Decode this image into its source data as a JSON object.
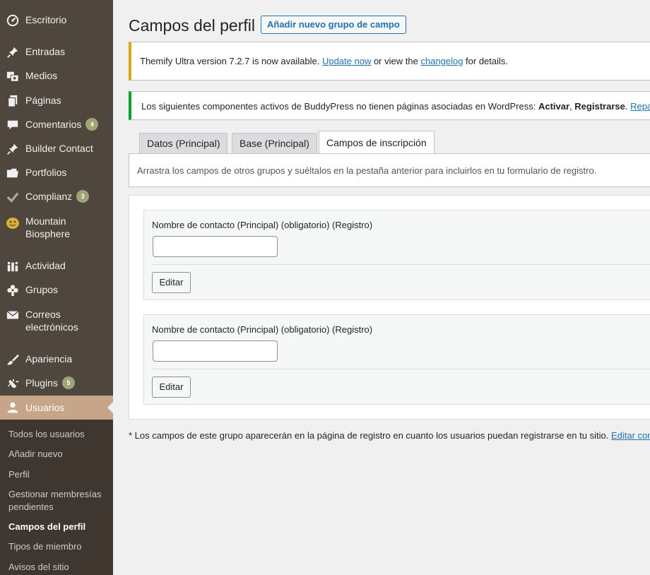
{
  "sidebar": {
    "items": [
      {
        "label": "Escritorio",
        "icon": "dashboard-icon"
      },
      {
        "label": "Entradas",
        "icon": "pin-icon"
      },
      {
        "label": "Medios",
        "icon": "media-icon"
      },
      {
        "label": "Páginas",
        "icon": "pages-icon"
      },
      {
        "label": "Comentarios",
        "icon": "comments-icon",
        "badge": "4"
      },
      {
        "label": "Builder Contact",
        "icon": "pin-icon"
      },
      {
        "label": "Portfolios",
        "icon": "folder-icon"
      },
      {
        "label": "Complianz",
        "icon": "check-icon",
        "badge": "3"
      },
      {
        "label": "Mountain Biosphere",
        "icon": "face-icon"
      },
      {
        "label": "Actividad",
        "icon": "activity-icon"
      },
      {
        "label": "Grupos",
        "icon": "groups-icon"
      },
      {
        "label": "Correos electrónicos",
        "icon": "mail-icon"
      },
      {
        "label": "Apariencia",
        "icon": "brush-icon"
      },
      {
        "label": "Plugins",
        "icon": "plugin-icon",
        "badge": "5"
      },
      {
        "label": "Usuarios",
        "icon": "user-icon",
        "active": true
      }
    ],
    "submenu": [
      {
        "label": "Todos los usuarios"
      },
      {
        "label": "Añadir nuevo"
      },
      {
        "label": "Perfil"
      },
      {
        "label": "Gestionar membresías pendientes"
      },
      {
        "label": "Campos del perfil",
        "current": true
      },
      {
        "label": "Tipos de miembro"
      },
      {
        "label": "Avisos del sitio"
      }
    ]
  },
  "header": {
    "title": "Campos del perfil",
    "add_button": "Añadir nuevo grupo de campo"
  },
  "notices": {
    "update": {
      "before": "Themify Ultra version 7.2.7 is now available. ",
      "link1": "Update now",
      "middle": " or view the ",
      "link2": "changelog",
      "after": " for details."
    },
    "buddypress": {
      "text": "Los siguientes componentes activos de BuddyPress no tienen páginas asociadas en WordPress: ",
      "bold1": "Activar",
      "sep": ", ",
      "bold2": "Registrarse",
      "dot": ". ",
      "link": "Reparar"
    }
  },
  "tabs": [
    {
      "label": "Datos (Principal)"
    },
    {
      "label": "Base (Principal)"
    },
    {
      "label": "Campos de inscripción",
      "active": true
    }
  ],
  "panel": {
    "description": "Arrastra los campos de otros grupos y suéltalos en la pestaña anterior para incluirlos en tu formulario de registro."
  },
  "fields": [
    {
      "label": "Nombre de contacto (Principal) (obligatorio) (Registro)",
      "value": "",
      "edit": "Editar"
    },
    {
      "label": "Nombre de contacto (Principal) (obligatorio) (Registro)",
      "value": "",
      "edit": "Editar"
    }
  ],
  "footnote": {
    "text": "* Los campos de este grupo aparecerán en la página de registro en cuanto los usuarios puedan registrarse en tu sitio. ",
    "link": "Editar conf"
  },
  "colors": {
    "sidebar_bg": "#4f463d",
    "active_bg": "#c7a589",
    "submenu_bg": "#3e362f",
    "link": "#2271b1",
    "badge": "#9ea476"
  }
}
